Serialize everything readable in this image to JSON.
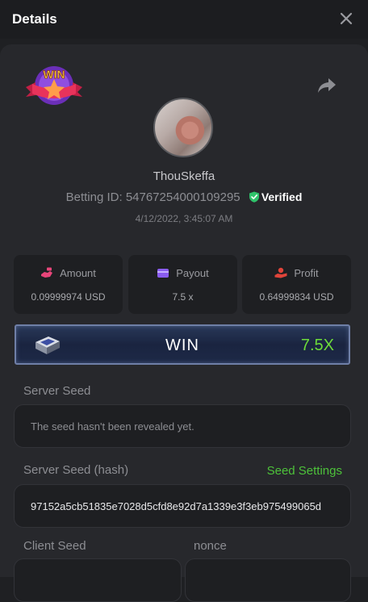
{
  "header": {
    "title": "Details"
  },
  "user": {
    "name": "ThouSkeffa",
    "betting_id_label": "Betting ID:",
    "betting_id": "54767254000109295",
    "verified": "Verified",
    "timestamp": "4/12/2022, 3:45:07 AM"
  },
  "stats": [
    {
      "label": "Amount",
      "value": "0.09999974 USD",
      "icon": "money-icon",
      "color": "#e8457a"
    },
    {
      "label": "Payout",
      "value": "7.5 x",
      "icon": "wallet-icon",
      "color": "#8a5cf0"
    },
    {
      "label": "Profit",
      "value": "0.64999834 USD",
      "icon": "profit-hand-icon",
      "color": "#e0443a"
    }
  ],
  "result": {
    "label": "WIN",
    "multiplier": "7.5X",
    "multiplier_color": "#6ddc3a"
  },
  "server_seed": {
    "label": "Server Seed",
    "value": "The seed hasn't been revealed yet."
  },
  "server_seed_hash": {
    "label": "Server Seed (hash)",
    "link": "Seed Settings",
    "value": "97152a5cb51835e7028d5cfd8e92d7a1339e3f3eb975499065d"
  },
  "client_seed": {
    "label": "Client Seed"
  },
  "nonce": {
    "label": "nonce"
  },
  "colors": {
    "accent_green": "#4dc23a",
    "verified_green": "#2fc36b"
  }
}
